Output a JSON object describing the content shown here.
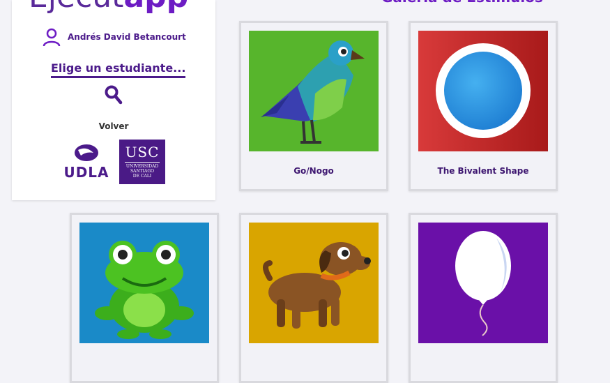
{
  "brand": {
    "part1": "Ejecut",
    "part2": "app"
  },
  "user": {
    "name": "Andrés David Betancourt"
  },
  "student_picker": {
    "label": "Elige un estudiante..."
  },
  "back": {
    "label": "Volver"
  },
  "logos": {
    "udla": "UDLA",
    "usc": "USC",
    "usc_small": [
      "UNIVERSIDAD",
      "SANTIAGO",
      "DE CALI"
    ]
  },
  "gallery": {
    "title": "Galería de Estímulos",
    "cards": [
      {
        "label": "Go/Nogo",
        "icon": "bird-icon",
        "bg": "#57b52c"
      },
      {
        "label": "The Bivalent Shape",
        "icon": "blue-circle-icon",
        "bg": "#c42a2a"
      },
      {
        "label": "",
        "icon": "frog-icon",
        "bg": "#1a8ac8"
      },
      {
        "label": "",
        "icon": "dog-icon",
        "bg": "#d9a500"
      },
      {
        "label": "",
        "icon": "balloon-icon",
        "bg": "#6a10a8"
      }
    ]
  }
}
